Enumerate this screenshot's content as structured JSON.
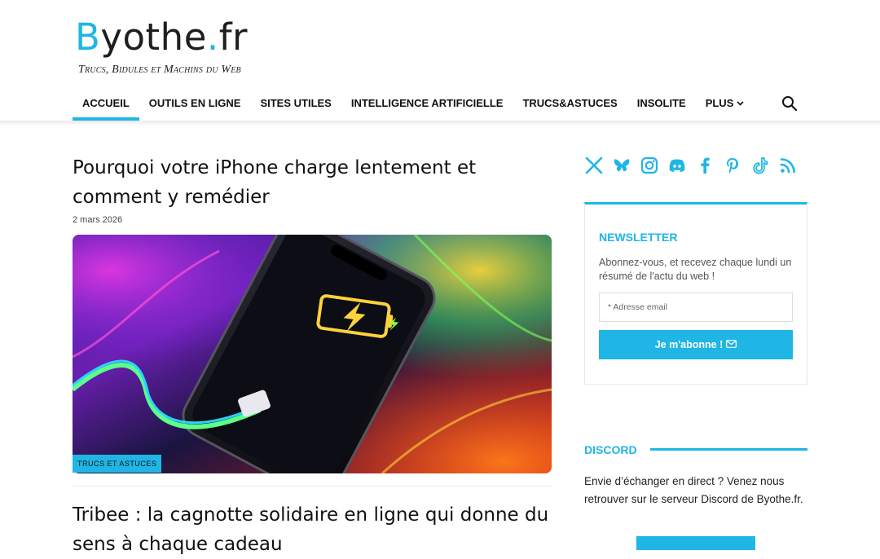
{
  "site": {
    "logo_first": "B",
    "logo_mid": "yothe",
    "logo_dot": ".",
    "logo_end": "fr",
    "tagline": "Trucs, Bidules et Machins du Web"
  },
  "nav": {
    "items": [
      {
        "label": "ACCUEIL",
        "active": true
      },
      {
        "label": "OUTILS EN LIGNE"
      },
      {
        "label": "SITES UTILES"
      },
      {
        "label": "INTELLIGENCE ARTIFICIELLE"
      },
      {
        "label": "TRUCS&ASTUCES"
      },
      {
        "label": "INSOLITE"
      }
    ],
    "more_label": "PLUS",
    "search_icon": "search-icon"
  },
  "articles": [
    {
      "title": "Pourquoi votre iPhone charge lentement et comment y remédier",
      "date": "2 mars 2026",
      "category": "TRUCS ET ASTUCES",
      "image": "phone-charging-illustration"
    },
    {
      "title": "Tribee : la cagnotte solidaire en ligne qui donne du sens à chaque cadeau"
    }
  ],
  "sidebar": {
    "socials": [
      "x-icon",
      "bluesky-icon",
      "instagram-icon",
      "discord-icon",
      "facebook-icon",
      "pinterest-icon",
      "tiktok-icon",
      "rss-icon"
    ],
    "newsletter": {
      "title": "NEWSLETTER",
      "text": "Abonnez-vous, et recevez chaque lundi un résumé de l'actu du web !",
      "placeholder": "* Adresse email",
      "button_label": "Je m'abonne !"
    },
    "discord": {
      "title": "DISCORD",
      "text": "Envie d’échanger en direct ? Venez nous retrouver sur le serveur Discord de Byothe.fr."
    }
  },
  "colors": {
    "accent": "#1fb6e6",
    "text": "#111111"
  }
}
